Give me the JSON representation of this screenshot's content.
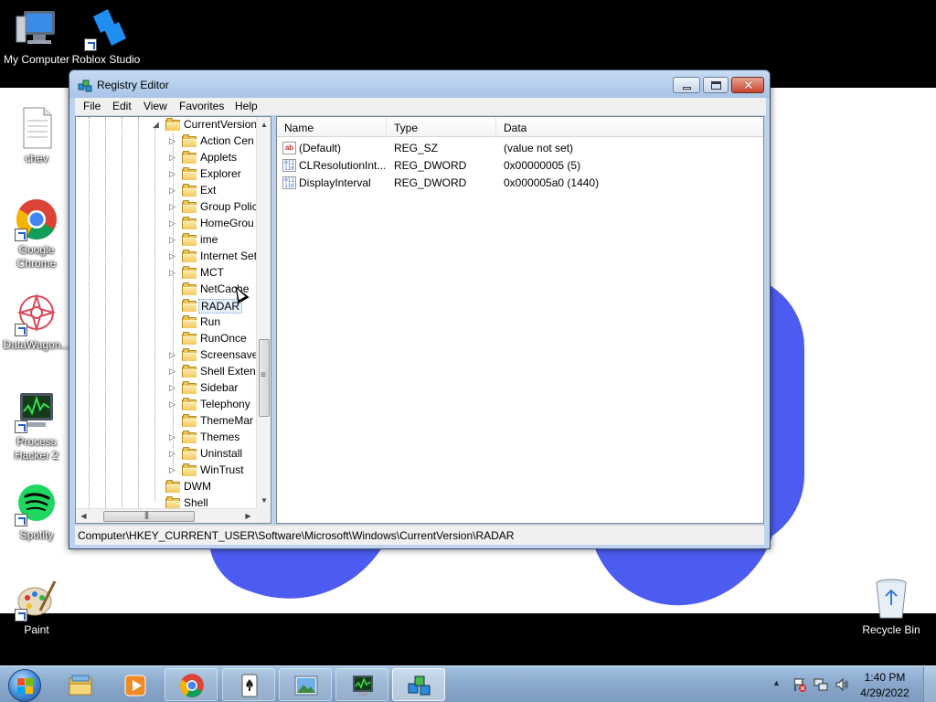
{
  "desktop": {
    "icons": [
      {
        "label": "My Computer",
        "icon": "computer-icon"
      },
      {
        "label": "Roblox Studio",
        "icon": "roblox-studio-icon"
      },
      {
        "label": "chev",
        "icon": "text-document-icon"
      },
      {
        "label": "Google Chrome",
        "icon": "chrome-icon"
      },
      {
        "label": "DataWagon...",
        "icon": "datawagon-icon"
      },
      {
        "label": "Process Hacker 2",
        "icon": "process-hacker-icon"
      },
      {
        "label": "Spotify",
        "icon": "spotify-icon"
      },
      {
        "label": "Paint",
        "icon": "paint-icon"
      },
      {
        "label": "Recycle Bin",
        "icon": "recycle-bin-icon"
      }
    ]
  },
  "window": {
    "title": "Registry Editor",
    "menu": [
      "File",
      "Edit",
      "View",
      "Favorites",
      "Help"
    ],
    "tree": {
      "parent": "CurrentVersion",
      "children": [
        {
          "label": "Action Cen",
          "expandable": true
        },
        {
          "label": "Applets",
          "expandable": true
        },
        {
          "label": "Explorer",
          "expandable": true
        },
        {
          "label": "Ext",
          "expandable": true
        },
        {
          "label": "Group Polic",
          "expandable": true
        },
        {
          "label": "HomeGrou",
          "expandable": true
        },
        {
          "label": "ime",
          "expandable": true
        },
        {
          "label": "Internet Set",
          "expandable": true
        },
        {
          "label": "MCT",
          "expandable": true
        },
        {
          "label": "NetCache",
          "expandable": false
        },
        {
          "label": "RADAR",
          "expandable": false,
          "selected": true
        },
        {
          "label": "Run",
          "expandable": false
        },
        {
          "label": "RunOnce",
          "expandable": false
        },
        {
          "label": "Screensave",
          "expandable": true
        },
        {
          "label": "Shell Extens",
          "expandable": true
        },
        {
          "label": "Sidebar",
          "expandable": true
        },
        {
          "label": "Telephony",
          "expandable": true
        },
        {
          "label": "ThemeMar",
          "expandable": false
        },
        {
          "label": "Themes",
          "expandable": true
        },
        {
          "label": "Uninstall",
          "expandable": true
        },
        {
          "label": "WinTrust",
          "expandable": true
        }
      ],
      "siblings": [
        "DWM",
        "Shell"
      ]
    },
    "list": {
      "columns": [
        "Name",
        "Type",
        "Data"
      ],
      "rows": [
        {
          "name": "(Default)",
          "type": "REG_SZ",
          "data": "(value not set)",
          "icon": "string-value-icon"
        },
        {
          "name": "CLResolutionInt...",
          "type": "REG_DWORD",
          "data": "0x00000005 (5)",
          "icon": "binary-value-icon"
        },
        {
          "name": "DisplayInterval",
          "type": "REG_DWORD",
          "data": "0x000005a0 (1440)",
          "icon": "binary-value-icon"
        }
      ]
    },
    "status_path": "Computer\\HKEY_CURRENT_USER\\Software\\Microsoft\\Windows\\CurrentVersion\\RADAR"
  },
  "taskbar": {
    "items": [
      {
        "name": "windows-explorer",
        "icon": "folder-library-icon"
      },
      {
        "name": "media-player",
        "icon": "media-player-icon"
      },
      {
        "name": "chrome",
        "icon": "chrome-icon"
      },
      {
        "name": "solitaire",
        "icon": "solitaire-icon"
      },
      {
        "name": "photo-viewer",
        "icon": "photo-viewer-icon"
      },
      {
        "name": "process-hacker",
        "icon": "process-hacker-icon"
      },
      {
        "name": "registry-editor",
        "icon": "registry-editor-icon",
        "active": true
      }
    ],
    "clock": {
      "time": "1:40 PM",
      "date": "4/29/2022"
    }
  }
}
